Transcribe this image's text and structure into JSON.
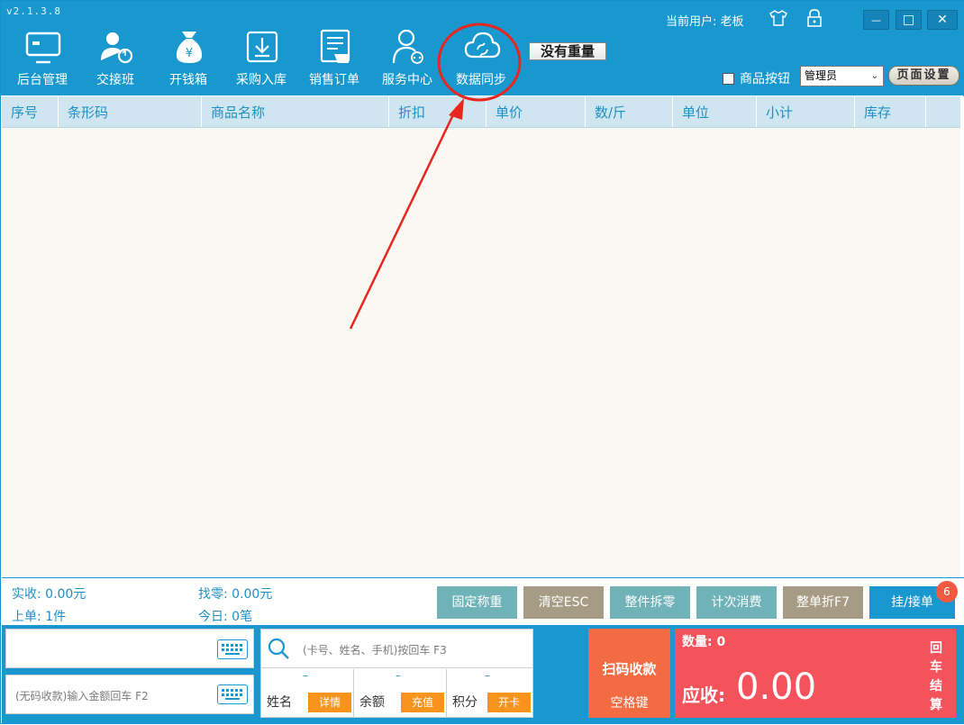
{
  "app": {
    "version": "v2.1.3.8"
  },
  "topbar": {
    "current_user_label": "当前用户: 老板",
    "icons": [
      "shirt-icon",
      "lock-icon"
    ],
    "window_buttons": {
      "minimize": "—",
      "maximize": "□",
      "close": "✕"
    }
  },
  "nav": {
    "items": [
      {
        "label": "后台管理",
        "icon": "monitor-icon"
      },
      {
        "label": "交接班",
        "icon": "user-sync-icon"
      },
      {
        "label": "开钱箱",
        "icon": "money-bag-icon"
      },
      {
        "label": "采购入库",
        "icon": "download-box-icon"
      },
      {
        "label": "销售订单",
        "icon": "order-doc-icon"
      },
      {
        "label": "服务中心",
        "icon": "support-user-icon"
      },
      {
        "label": "数据同步",
        "icon": "cloud-sync-icon"
      }
    ]
  },
  "scale_status": "没有重量",
  "options": {
    "product_button_label": "商品按钮",
    "product_button_checked": false,
    "role_selected": "管理员",
    "page_settings_label": "页面设置"
  },
  "table": {
    "columns": [
      "序号",
      "条形码",
      "商品名称",
      "折扣",
      "单价",
      "数/斤",
      "单位",
      "小计",
      "库存"
    ],
    "rows": []
  },
  "summary": {
    "received": "实收: 0.00元",
    "change": "找零: 0.00元",
    "last_order": "上单: 1件",
    "today": "今日: 0笔"
  },
  "actions": [
    {
      "label": "固定称重",
      "color": "#6fb3b9"
    },
    {
      "label": "清空ESC",
      "color": "#a69c85"
    },
    {
      "label": "整件拆零",
      "color": "#6fb3b9"
    },
    {
      "label": "计次消费",
      "color": "#6fb3b9"
    },
    {
      "label": "整单折F7",
      "color": "#a69c85"
    },
    {
      "label": "挂/接单",
      "color": "#1998cf"
    }
  ],
  "pending_badge": "6",
  "inputs": {
    "scan_placeholder": "",
    "amount_placeholder": "(无码收款)输入金额回车 F2",
    "member_search_placeholder": "(卡号、姓名、手机)按回车 F3"
  },
  "member": {
    "fields": [
      {
        "label": "姓名",
        "value": "–",
        "button": "详情"
      },
      {
        "label": "余额",
        "value": "–",
        "button": "充值"
      },
      {
        "label": "积分",
        "value": "–",
        "button": "开卡"
      }
    ]
  },
  "checkout": {
    "scan_pay_label": "扫码收款",
    "scan_pay_key": "空格键",
    "quantity_label": "数量: 0",
    "due_label": "应收:",
    "due_amount": "0.00",
    "settle_label": "回车结算"
  },
  "colors": {
    "topbar": "#1998cf",
    "accent_text": "#1f8fc4",
    "orange": "#f7941d",
    "scan_button": "#f26b43",
    "total_panel": "#f5535c",
    "annotation": "#e8251f"
  }
}
